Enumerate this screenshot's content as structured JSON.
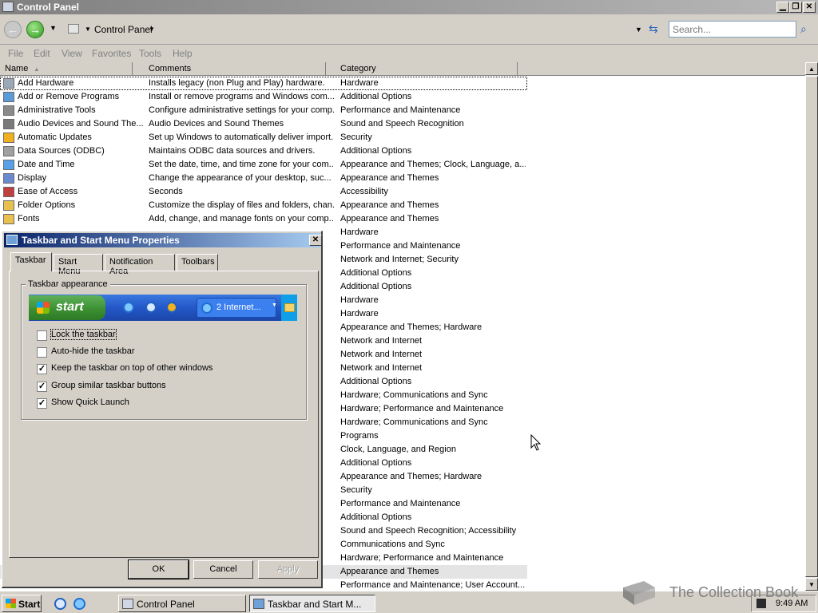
{
  "window": {
    "title": "Control Panel"
  },
  "address": {
    "crumb": "Control Panel",
    "search_placeholder": "Search..."
  },
  "menu": [
    "File",
    "Edit",
    "View",
    "Favorites",
    "Tools",
    "Help"
  ],
  "list": {
    "columns": [
      "Name",
      "Comments",
      "Category"
    ],
    "rows": [
      {
        "name": "Add Hardware",
        "comment": "Installs legacy (non Plug and Play) hardware.",
        "category": "Hardware"
      },
      {
        "name": "Add or Remove Programs",
        "comment": "Install or remove programs and Windows com...",
        "category": "Additional Options"
      },
      {
        "name": "Administrative Tools",
        "comment": "Configure administrative settings for your comp...",
        "category": "Performance and Maintenance"
      },
      {
        "name": "Audio Devices and Sound The...",
        "comment": "Audio Devices and Sound Themes",
        "category": "Sound and Speech Recognition"
      },
      {
        "name": "Automatic Updates",
        "comment": "Set up Windows to automatically deliver import...",
        "category": "Security"
      },
      {
        "name": "Data Sources (ODBC)",
        "comment": "Maintains ODBC data sources and drivers.",
        "category": "Additional Options"
      },
      {
        "name": "Date and Time",
        "comment": "Set the date, time, and time zone for your com...",
        "category": "Appearance and Themes; Clock, Language, a..."
      },
      {
        "name": "Display",
        "comment": "Change the appearance of your desktop, suc...",
        "category": "Appearance and Themes"
      },
      {
        "name": "Ease of Access",
        "comment": "Seconds",
        "category": "Accessibility"
      },
      {
        "name": "Folder Options",
        "comment": "Customize the display of files and folders, chan...",
        "category": "Appearance and Themes"
      },
      {
        "name": "Fonts",
        "comment": "Add, change, and manage fonts on your comp...",
        "category": "Appearance and Themes"
      },
      {
        "name": "",
        "comment": "",
        "category": "Hardware"
      },
      {
        "name": "",
        "comment": "",
        "category": "Performance and Maintenance"
      },
      {
        "name": "",
        "comment": "",
        "category": "Network and Internet; Security"
      },
      {
        "name": "",
        "comment": "",
        "category": "Additional Options"
      },
      {
        "name": "",
        "comment": "",
        "category": "Additional Options"
      },
      {
        "name": "",
        "comment": "",
        "category": "Hardware"
      },
      {
        "name": "",
        "comment": "",
        "category": "Hardware"
      },
      {
        "name": "",
        "comment": "",
        "category": "Appearance and Themes; Hardware"
      },
      {
        "name": "",
        "comment": "",
        "category": "Network and Internet"
      },
      {
        "name": "",
        "comment": "",
        "category": "Network and Internet"
      },
      {
        "name": "",
        "comment": "",
        "category": "Network and Internet"
      },
      {
        "name": "",
        "comment": "",
        "category": "Additional Options"
      },
      {
        "name": "",
        "comment": "",
        "category": "Hardware; Communications and Sync"
      },
      {
        "name": "",
        "comment": "",
        "category": "Hardware; Performance and Maintenance"
      },
      {
        "name": "",
        "comment": "",
        "category": "Hardware; Communications and Sync"
      },
      {
        "name": "",
        "comment": "",
        "category": "Programs"
      },
      {
        "name": "",
        "comment": "",
        "category": "Clock, Language, and Region"
      },
      {
        "name": "",
        "comment": "",
        "category": "Additional Options"
      },
      {
        "name": "",
        "comment": "",
        "category": "Appearance and Themes; Hardware"
      },
      {
        "name": "",
        "comment": "",
        "category": "Security"
      },
      {
        "name": "",
        "comment": "",
        "category": "Performance and Maintenance"
      },
      {
        "name": "",
        "comment": "",
        "category": "Additional Options"
      },
      {
        "name": "",
        "comment": "",
        "category": "Sound and Speech Recognition; Accessibility"
      },
      {
        "name": "",
        "comment": "",
        "category": "Communications and Sync"
      },
      {
        "name": "",
        "comment": "",
        "category": "Hardware; Performance and Maintenance"
      },
      {
        "name": "",
        "comment": "",
        "category": "Appearance and Themes"
      },
      {
        "name": "",
        "comment": "",
        "category": "Performance and Maintenance; User Account..."
      }
    ]
  },
  "dialog": {
    "title": "Taskbar and Start Menu Properties",
    "tabs": [
      "Taskbar",
      "Start Menu",
      "Notification Area",
      "Toolbars"
    ],
    "group_label": "Taskbar appearance",
    "preview": {
      "start_label": "start",
      "task_label": "2 Internet..."
    },
    "checkboxes": [
      {
        "label": "Lock the taskbar",
        "checked": false
      },
      {
        "label": "Auto-hide the taskbar",
        "checked": false
      },
      {
        "label": "Keep the taskbar on top of other windows",
        "checked": true
      },
      {
        "label": "Group similar taskbar buttons",
        "checked": true
      },
      {
        "label": "Show Quick Launch",
        "checked": true
      }
    ],
    "buttons": {
      "ok": "OK",
      "cancel": "Cancel",
      "apply": "Apply"
    }
  },
  "taskbar": {
    "start_label": "Start",
    "tasks": [
      {
        "label": "Control Panel",
        "active": false
      },
      {
        "label": "Taskbar and Start M...",
        "active": true
      }
    ],
    "clock": "9:49 AM"
  },
  "watermark": {
    "text": "The Collection Book"
  },
  "colors": {
    "dialog_title": "#0a246a",
    "start_green": "#3a8e30",
    "xp_blue": "#2457c8"
  }
}
